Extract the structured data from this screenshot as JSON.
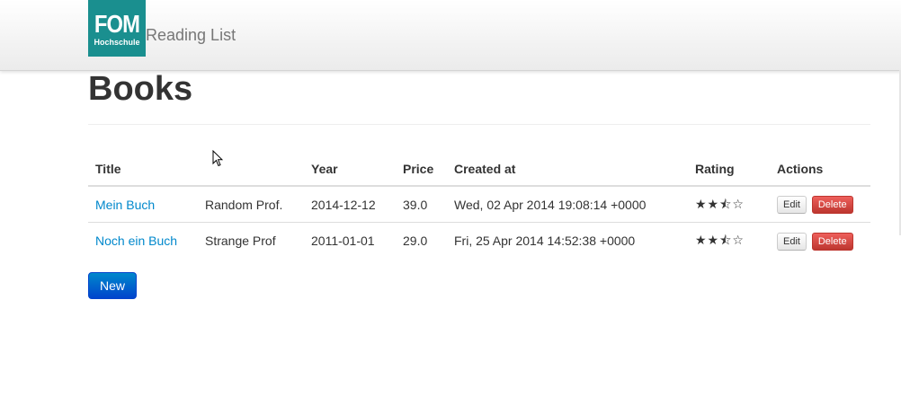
{
  "navbar": {
    "logo_main": "FOM",
    "logo_sub": "Hochschule",
    "brand": "Reading List"
  },
  "page": {
    "title": "Books"
  },
  "table": {
    "headers": {
      "title": "Title",
      "author": "",
      "year": "Year",
      "price": "Price",
      "created_at": "Created at",
      "rating": "Rating",
      "actions": "Actions"
    },
    "rows": [
      {
        "title": "Mein Buch",
        "author": "Random Prof.",
        "year": "2014-12-12",
        "price": "39.0",
        "created_at": "Wed, 02 Apr 2014 19:08:14 +0000",
        "rating": 2.5,
        "rating_stars": "★★⯪☆",
        "edit_label": "Edit",
        "delete_label": "Delete"
      },
      {
        "title": "Noch ein Buch",
        "author": "Strange Prof",
        "year": "2011-01-01",
        "price": "29.0",
        "created_at": "Fri, 25 Apr 2014 14:52:38 +0000",
        "rating": 2.5,
        "rating_stars": "★★⯪☆",
        "edit_label": "Edit",
        "delete_label": "Delete"
      }
    ]
  },
  "actions": {
    "new_label": "New"
  },
  "colors": {
    "logo_bg": "#1a8f8f",
    "link": "#0088cc",
    "primary_button": "#0055cc",
    "danger_button": "#da4f49"
  },
  "icons": {
    "rating_full": "star-icon",
    "rating_half": "half-star-icon",
    "rating_empty": "empty-star-icon",
    "pointer": "mouse-cursor-icon"
  }
}
